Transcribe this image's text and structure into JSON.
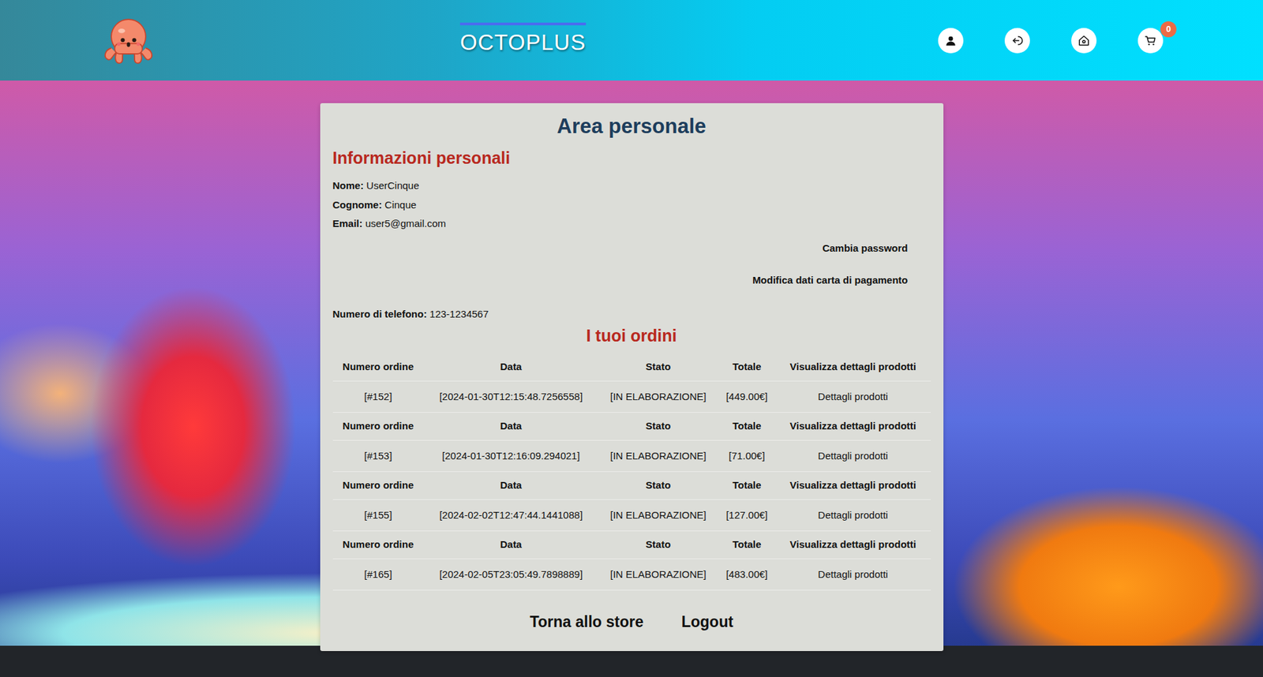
{
  "header": {
    "brand": "OCTOPLUS",
    "cart_count": "0"
  },
  "page": {
    "title": "Area personale"
  },
  "personal": {
    "title": "Informazioni personali",
    "fields": [
      {
        "label": "Nome:",
        "value": "UserCinque"
      },
      {
        "label": "Cognome:",
        "value": "Cinque"
      },
      {
        "label": "Email:",
        "value": "user5@gmail.com"
      }
    ],
    "links": [
      "Cambia password",
      "Modifica dati carta di pagamento"
    ],
    "phone": {
      "label": "Numero di telefono:",
      "value": "123-1234567"
    }
  },
  "orders": {
    "title": "I tuoi ordini",
    "columns": [
      "Numero ordine",
      "Data",
      "Stato",
      "Totale",
      "Visualizza dettagli prodotti"
    ],
    "rows": [
      [
        "[#152]",
        "[2024-01-30T12:15:48.7256558]",
        "[IN ELABORAZIONE]",
        "[449.00€]",
        "Dettagli prodotti"
      ],
      [
        "[#153]",
        "[2024-01-30T12:16:09.294021]",
        "[IN ELABORAZIONE]",
        "[71.00€]",
        "Dettagli prodotti"
      ],
      [
        "[#155]",
        "[2024-02-02T12:47:44.1441088]",
        "[IN ELABORAZIONE]",
        "[127.00€]",
        "Dettagli prodotti"
      ],
      [
        "[#165]",
        "[2024-02-05T23:05:49.7898889]",
        "[IN ELABORAZIONE]",
        "[483.00€]",
        "Dettagli prodotti"
      ]
    ]
  },
  "actions": [
    "Torna allo store",
    "Logout"
  ]
}
